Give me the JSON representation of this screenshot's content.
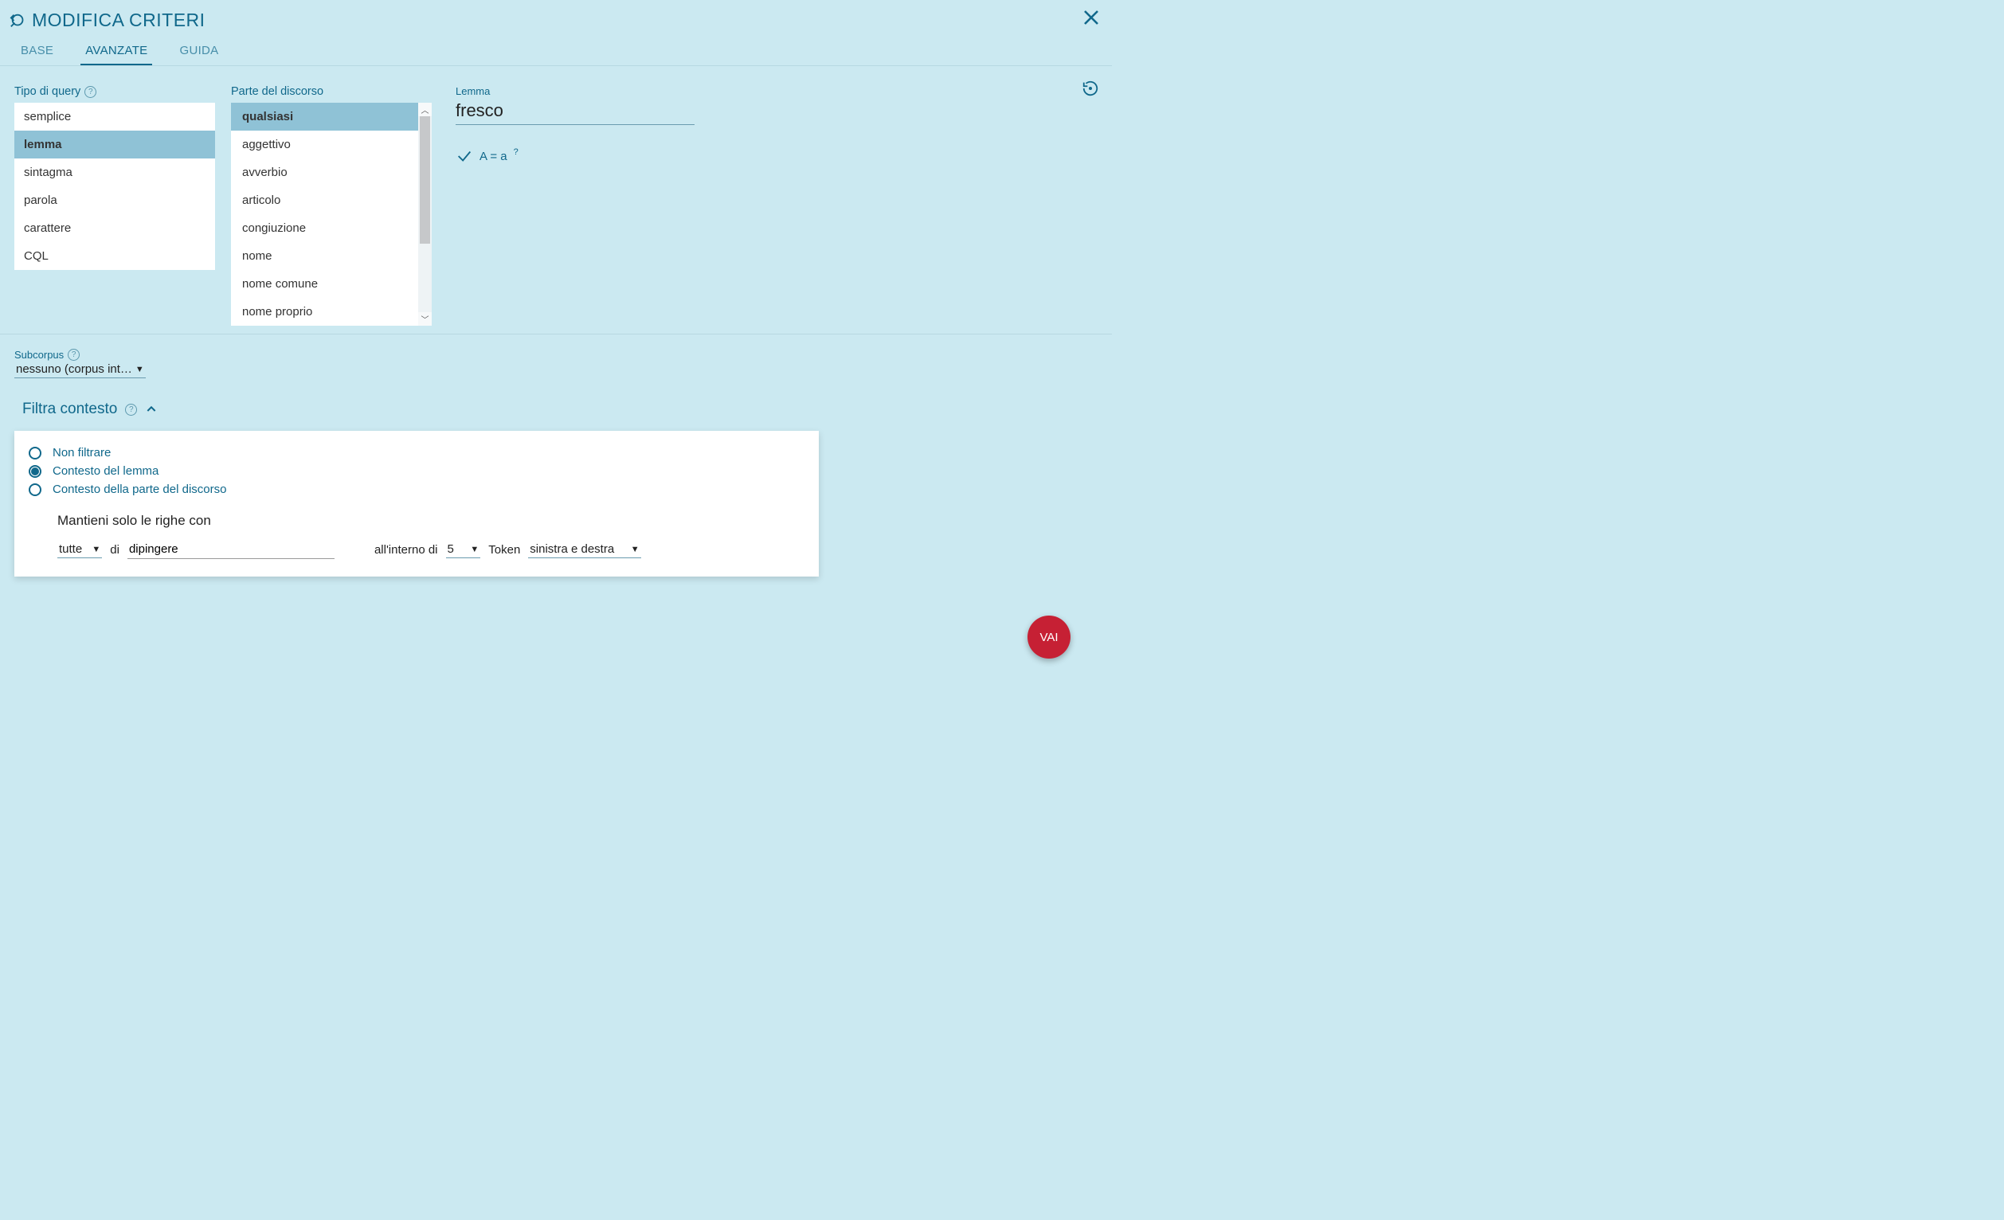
{
  "header": {
    "title": "MODIFICA CRITERI"
  },
  "tabs": {
    "base": "BASE",
    "advanced": "AVANZATE",
    "guide": "GUIDA",
    "active": "AVANZATE"
  },
  "queryType": {
    "label": "Tipo di query",
    "items": [
      "semplice",
      "lemma",
      "sintagma",
      "parola",
      "carattere",
      "CQL"
    ],
    "selected": "lemma"
  },
  "pos": {
    "label": "Parte del discorso",
    "items": [
      "qualsiasi",
      "aggettivo",
      "avverbio",
      "articolo",
      "congiuzione",
      "nome",
      "nome comune",
      "nome proprio"
    ],
    "selected": "qualsiasi"
  },
  "lemma": {
    "label": "Lemma",
    "value": "fresco"
  },
  "caseCheck": {
    "label": "A = a"
  },
  "subcorpus": {
    "label": "Subcorpus",
    "value": "nessuno (corpus int…"
  },
  "filter": {
    "title": "Filtra contesto",
    "options": {
      "none": "Non filtrare",
      "lemma": "Contesto del lemma",
      "pos": "Contesto della parte del discorso"
    },
    "selected": "lemma",
    "keepLabel": "Mantieni solo le righe con",
    "all": "tutte",
    "ofLabel": "di",
    "ofValue": "dipingere",
    "withinLabel": "all'interno di",
    "withinValue": "5",
    "tokenLabel": "Token",
    "direction": "sinistra e destra"
  },
  "fab": {
    "label": "VAI"
  }
}
